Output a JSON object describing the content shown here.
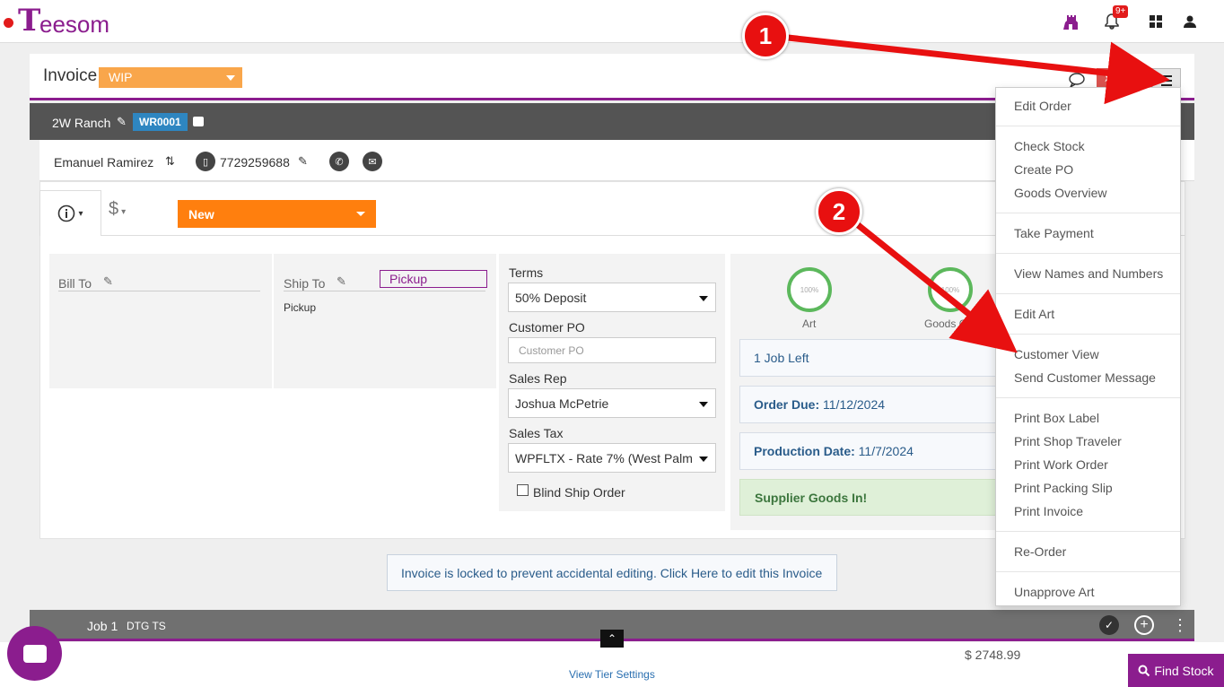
{
  "app": {
    "logo_letter": "T",
    "logo_rest": "eesom",
    "notif_count": "9+"
  },
  "invoice": {
    "title": "Invoice",
    "status": "WIP",
    "send_label": "Se"
  },
  "customer": {
    "company": "2W Ranch",
    "code": "WR0001",
    "contact": "Emanuel Ramirez",
    "phone": "7729259688"
  },
  "tabs": {
    "money_symbol": "$",
    "stage": "New"
  },
  "addresses": {
    "bill_to": "Bill To",
    "ship_to": "Ship To",
    "ship_tag": "Pickup",
    "ship_value": "Pickup"
  },
  "form": {
    "terms_label": "Terms",
    "terms_value": "50% Deposit",
    "po_label": "Customer PO",
    "po_placeholder": "Customer PO",
    "rep_label": "Sales Rep",
    "rep_value": "Joshua McPetrie",
    "tax_label": "Sales Tax",
    "tax_value": "WPFLTX - Rate 7% (West Palm",
    "blind_label": "Blind Ship Order"
  },
  "status": {
    "art_pct": "100%",
    "art_label": "Art",
    "goods_pct": "100%",
    "goods_label": "Goods Ord",
    "jobs_left": "1 Job Left",
    "order_due_label": "Order Due:",
    "order_due": "11/12/2024",
    "production_label": "Production Date:",
    "production": "11/7/2024",
    "supplier": "Supplier Goods In!"
  },
  "notice": "Invoice is locked to prevent accidental editing. Click Here to edit this Invoice",
  "job": {
    "label": "Job 1",
    "type": "DTG TS",
    "price": "$ 2748.99",
    "tier_link": "View Tier Settings"
  },
  "find_stock": "Find Stock",
  "menu": {
    "items": [
      "Edit Order",
      "Check Stock",
      "Create PO",
      "Goods Overview",
      "Take Payment",
      "View Names and Numbers",
      "Edit Art",
      "Customer View",
      "Send Customer Message",
      "Print Box Label",
      "Print Shop Traveler",
      "Print Work Order",
      "Print Packing Slip",
      "Print Invoice",
      "Re-Order",
      "Unapprove Art"
    ]
  },
  "callouts": [
    "1",
    "2"
  ],
  "colors": {
    "brand": "#8b1d8e",
    "wip": "#f9a64b",
    "stage": "#ff7f0e",
    "callout": "#e81010"
  }
}
